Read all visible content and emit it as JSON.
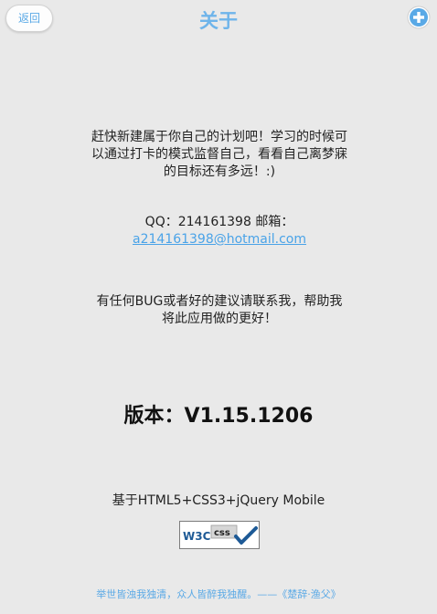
{
  "header": {
    "back_label": "返回",
    "title": "关于",
    "add_icon": "plus-circle-icon"
  },
  "main": {
    "slogan": "赶快新建属于你自己的计划吧！学习的时候可以通过打卡的模式监督自己，看看自己离梦寐的目标还有多远！:)",
    "contact_prefix": "QQ：214161398 邮箱：",
    "email": "a214161398@hotmail.com",
    "feedback": "有任何BUG或者好的建议请联系我，帮助我将此应用做的更好！",
    "version": "版本：V1.15.1206",
    "based_on": "基于HTML5+CSS3+jQuery Mobile",
    "badge_w3c": "W3C",
    "badge_css": "css"
  },
  "footer": {
    "quote": "举世皆浊我独清，众人皆醉我独醒。——《楚辞·渔父》"
  },
  "colors": {
    "accent": "#5aa9e6",
    "background": "#e9e9e9"
  }
}
